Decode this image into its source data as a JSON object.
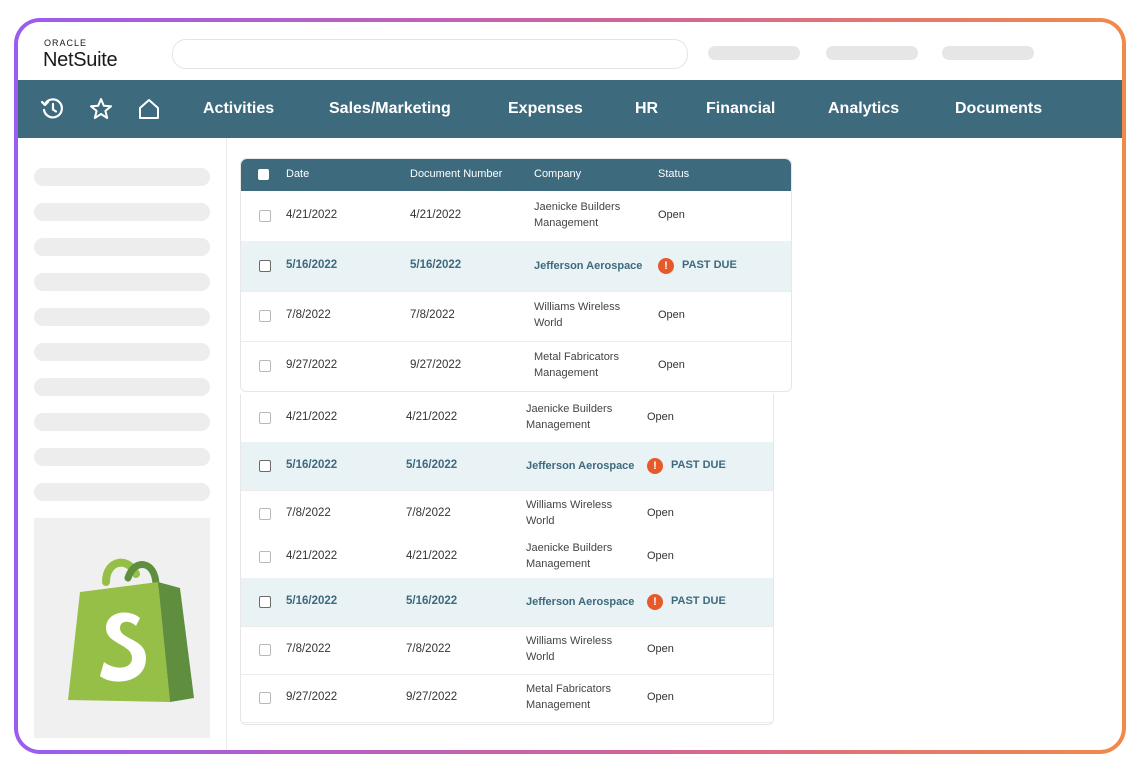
{
  "brand": {
    "line1": "ORACLE",
    "line2": "NetSuite"
  },
  "search": {
    "placeholder": ""
  },
  "nav": {
    "icons": [
      "history-icon",
      "star-icon",
      "home-icon"
    ],
    "items": [
      "Activities",
      "Sales/Marketing",
      "Expenses",
      "HR",
      "Financial",
      "Analytics",
      "Documents"
    ]
  },
  "table": {
    "headers": [
      "Date",
      "Document Number",
      "Company",
      "Status"
    ]
  },
  "block1": [
    {
      "date": "4/21/2022",
      "doc": "4/21/2022",
      "company": "Jaenicke Builders Management",
      "status": "Open",
      "past_due": false
    },
    {
      "date": "5/16/2022",
      "doc": "5/16/2022",
      "company": "Jefferson Aerospace",
      "status": "PAST DUE",
      "past_due": true
    },
    {
      "date": "7/8/2022",
      "doc": "7/8/2022",
      "company": "Williams Wireless World",
      "status": "Open",
      "past_due": false
    },
    {
      "date": "9/27/2022",
      "doc": "9/27/2022",
      "company": "Metal Fabricators Management",
      "status": "Open",
      "past_due": false
    }
  ],
  "block2": [
    {
      "date": "4/21/2022",
      "doc": "4/21/2022",
      "company": "Jaenicke Builders Management",
      "status": "Open",
      "past_due": false
    },
    {
      "date": "5/16/2022",
      "doc": "5/16/2022",
      "company": "Jefferson Aerospace",
      "status": "PAST DUE",
      "past_due": true
    },
    {
      "date": "7/8/2022",
      "doc": "7/8/2022",
      "company": "Williams Wireless World",
      "status": "Open",
      "past_due": false
    }
  ],
  "block3": [
    {
      "date": "4/21/2022",
      "doc": "4/21/2022",
      "company": "Jaenicke Builders Management",
      "status": "Open",
      "past_due": false
    },
    {
      "date": "5/16/2022",
      "doc": "5/16/2022",
      "company": "Jefferson Aerospace",
      "status": "PAST DUE",
      "past_due": true
    },
    {
      "date": "7/8/2022",
      "doc": "7/8/2022",
      "company": "Williams Wireless World",
      "status": "Open",
      "past_due": false
    },
    {
      "date": "9/27/2022",
      "doc": "9/27/2022",
      "company": "Metal Fabricators Management",
      "status": "Open",
      "past_due": false
    }
  ],
  "colors": {
    "nav": "#3d6a7d",
    "alert": "#e8592a",
    "highlight": "#e9f2f4",
    "shopify_green": "#95bf47"
  }
}
